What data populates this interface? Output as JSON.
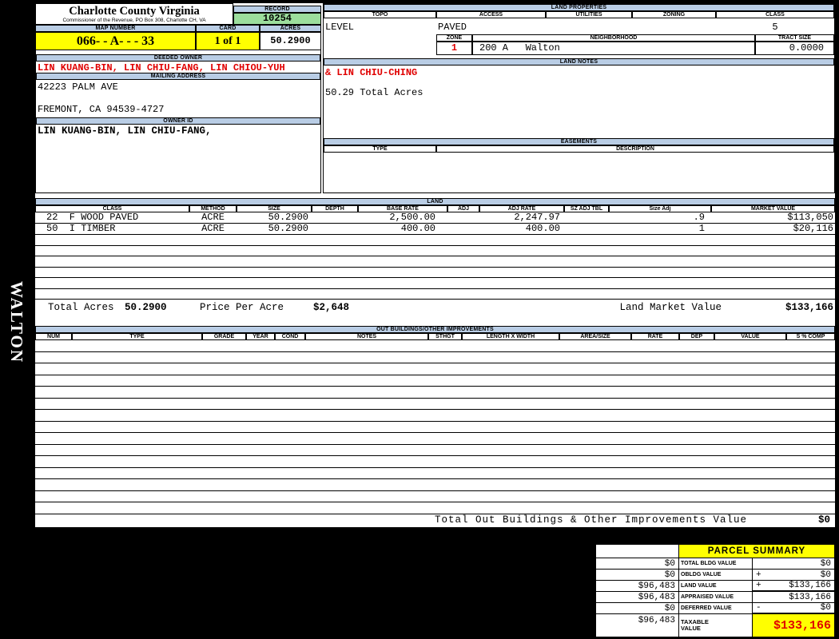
{
  "colors": {
    "header_blue": "#B9CDE5",
    "record_green": "#9CDE9C",
    "highlight_yellow": "#FFFF00",
    "alert_red": "#E00000"
  },
  "side": {
    "vertical_label": "WALTON"
  },
  "county": {
    "title": "Charlotte County Virginia",
    "subtitle": "Commissioner of the Revenue, PO Box 308, Charlotte CH, VA"
  },
  "record": {
    "label": "RECORD",
    "value": "10254"
  },
  "parcel": {
    "map_number_label": "MAP NUMBER",
    "map_number": "066- - A- - - 33",
    "card_label": "CARD",
    "card": "1 of 1",
    "acres_label": "ACRES",
    "acres": "50.2900",
    "deeded_owner_label": "DEEDED OWNER",
    "deeded_owner": "LIN KUANG-BIN, LIN CHIU-FANG, LIN CHIOU-YUH",
    "deeded_owner_cont": "& LIN CHIU-CHING",
    "mailing_address_label": "MAILING ADDRESS",
    "address_line1": "42223 PALM AVE",
    "address_line2": "FREMONT, CA 94539-4727",
    "owner_id_label": "OWNER ID",
    "owner_id": "LIN KUANG-BIN, LIN CHIU-FANG,"
  },
  "land_properties": {
    "label": "LAND PROPERTIES",
    "topo_label": "TOPO",
    "topo": "LEVEL",
    "access_label": "ACCESS",
    "access": "PAVED",
    "utilities_label": "UTILITIES",
    "utilities": "",
    "zoning_label": "ZONING",
    "zoning": "",
    "class_label": "CLASS",
    "class": "5",
    "zone_label": "ZONE",
    "zone": "1",
    "neighborhood_label": "NEIGHBORHOOD",
    "neighborhood": "200 A   Walton",
    "tract_size_label": "TRACT SIZE",
    "tract_size": "0.0000"
  },
  "land_notes": {
    "label": "LAND NOTES",
    "note": "50.29 Total Acres"
  },
  "easements": {
    "label": "EASEMENTS",
    "type_label": "TYPE",
    "description_label": "DESCRIPTION"
  },
  "land": {
    "label": "LAND",
    "columns": [
      "CLASS",
      "METHOD",
      "SIZE",
      "DEPTH",
      "BASE RATE",
      "ADJ",
      "ADJ RATE",
      "SZ ADJ TBL",
      "Size Adj",
      "MARKET VALUE"
    ],
    "rows": [
      [
        "22  F WOOD PAVED",
        "ACRE",
        "50.2900",
        "",
        "2,500.00",
        "",
        "2,247.97",
        "",
        ".9",
        "$113,050"
      ],
      [
        "50  I TIMBER",
        "ACRE",
        "50.2900",
        "",
        "400.00",
        "",
        "400.00",
        "",
        "1",
        "$20,116"
      ]
    ],
    "totals": {
      "total_acres_label": "Total Acres",
      "total_acres": "50.2900",
      "price_per_acre_label": "Price Per Acre",
      "price_per_acre": "$2,648",
      "market_value_label": "Land Market Value",
      "market_value": "$133,166"
    }
  },
  "out_buildings": {
    "label": "OUT BUILDINGS/OTHER IMPROVEMENTS",
    "columns": [
      "NUM",
      "TYPE",
      "GRADE",
      "YEAR",
      "COND",
      "NOTES",
      "STHGT",
      "LENGTH X WIDTH",
      "AREA/SIZE",
      "RATE",
      "DEP",
      "VALUE",
      "S % COMP"
    ],
    "total_label": "Total Out Buildings & Other Improvements Value",
    "total_value": "$0"
  },
  "summary": {
    "title": "PARCEL SUMMARY",
    "rows": [
      {
        "left": "$0",
        "label": "TOTAL BLDG VALUE",
        "op": "",
        "value": "$0"
      },
      {
        "left": "$0",
        "label": "OBLDG VALUE",
        "op": "+",
        "value": "$0"
      },
      {
        "left": "$96,483",
        "label": "LAND VALUE",
        "op": "+",
        "value": "$133,166"
      },
      {
        "left": "$96,483",
        "label": "APPRAISED VALUE",
        "op": "",
        "value": "$133,166"
      },
      {
        "left": "$0",
        "label": "DEFERRED VALUE",
        "op": "-",
        "value": "$0"
      },
      {
        "left": "$96,483",
        "label": "TAXABLE VALUE",
        "op": "",
        "value": "$133,166"
      }
    ]
  }
}
